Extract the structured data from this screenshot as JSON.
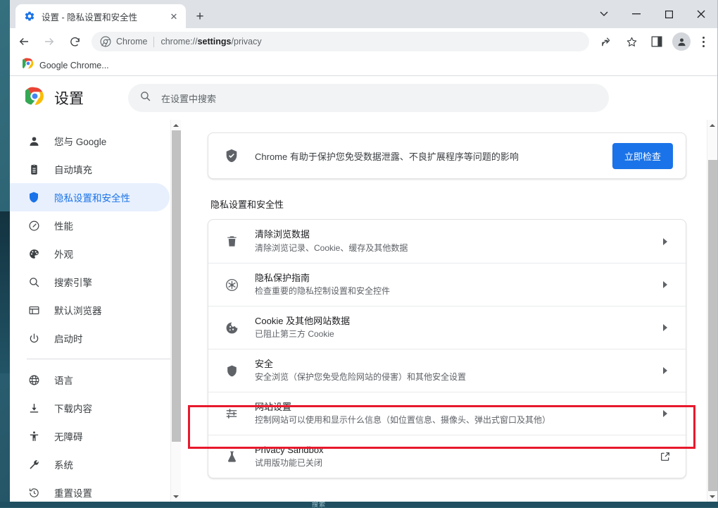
{
  "window": {
    "controls": [
      {
        "name": "tab-search",
        "glyph": "⌄"
      },
      {
        "name": "minimize",
        "glyph": "—"
      },
      {
        "name": "maximize",
        "glyph": "□"
      },
      {
        "name": "close",
        "glyph": "✕"
      }
    ]
  },
  "tab": {
    "title": "设置 - 隐私设置和安全性",
    "favicon": "gear-icon",
    "close_glyph": "✕",
    "newtab_glyph": "+"
  },
  "toolbar": {
    "back_glyph": "←",
    "forward_glyph": "→",
    "reload_glyph": "⟳",
    "security_label": "Chrome",
    "url_prefix": "chrome://",
    "url_bold": "settings",
    "url_suffix": "/privacy",
    "url_full": "chrome://settings/privacy",
    "share_icon": "share-icon",
    "bookmark_icon": "star-icon",
    "side_panel_icon": "side-panel-icon",
    "profile_icon": "avatar-icon",
    "menu_icon": "three-dots-icon"
  },
  "bookmarks": [
    {
      "label": "Google Chrome...",
      "icon": "chrome-icon"
    }
  ],
  "settings": {
    "logo": "chrome-icon",
    "title": "设置",
    "search_placeholder": "在设置中搜索",
    "search_value": "",
    "search_icon": "search-icon"
  },
  "sidebar": {
    "items": [
      {
        "label": "您与 Google",
        "icon": "person-icon",
        "active": false
      },
      {
        "label": "自动填充",
        "icon": "clipboard-icon",
        "active": false
      },
      {
        "label": "隐私设置和安全性",
        "icon": "shield-icon",
        "active": true
      },
      {
        "label": "性能",
        "icon": "speedometer-icon",
        "active": false
      },
      {
        "label": "外观",
        "icon": "palette-icon",
        "active": false
      },
      {
        "label": "搜索引擎",
        "icon": "search-icon",
        "active": false
      },
      {
        "label": "默认浏览器",
        "icon": "browser-window-icon",
        "active": false
      },
      {
        "label": "启动时",
        "icon": "power-icon",
        "active": false
      }
    ],
    "items2": [
      {
        "label": "语言",
        "icon": "globe-icon",
        "active": false
      },
      {
        "label": "下载内容",
        "icon": "download-icon",
        "active": false
      },
      {
        "label": "无障碍",
        "icon": "accessibility-icon",
        "active": false
      },
      {
        "label": "系统",
        "icon": "wrench-icon",
        "active": false
      },
      {
        "label": "重置设置",
        "icon": "history-restore-icon",
        "active": false
      }
    ]
  },
  "main": {
    "safety_check": {
      "icon": "shield-check-icon",
      "text": "Chrome 有助于保护您免受数据泄露、不良扩展程序等问题的影响",
      "button_label": "立即检查",
      "button_color": "#1a73e8"
    },
    "section_title": "隐私设置和安全性",
    "rows": [
      {
        "title": "清除浏览数据",
        "subtitle": "清除浏览记录、Cookie、缓存及其他数据",
        "icon": "trash-icon",
        "end": "caret"
      },
      {
        "title": "隐私保护指南",
        "subtitle": "检查重要的隐私控制设置和安全控件",
        "icon": "privacy-guide-icon",
        "end": "caret"
      },
      {
        "title": "Cookie 及其他网站数据",
        "subtitle": "已阻止第三方 Cookie",
        "icon": "cookie-icon",
        "end": "caret"
      },
      {
        "title": "安全",
        "subtitle": "安全浏览（保护您免受危险网站的侵害）和其他安全设置",
        "icon": "shield-icon",
        "end": "caret"
      },
      {
        "title": "网站设置",
        "subtitle": "控制网站可以使用和显示什么信息（如位置信息、摄像头、弹出式窗口及其他）",
        "icon": "tune-icon",
        "end": "caret",
        "highlighted": true
      },
      {
        "title": "Privacy Sandbox",
        "subtitle": "试用版功能已关闭",
        "icon": "flask-icon",
        "end": "external-link"
      }
    ]
  },
  "highlight": {
    "color": "#e8192c"
  },
  "taskbar": {
    "text": "搜索"
  }
}
